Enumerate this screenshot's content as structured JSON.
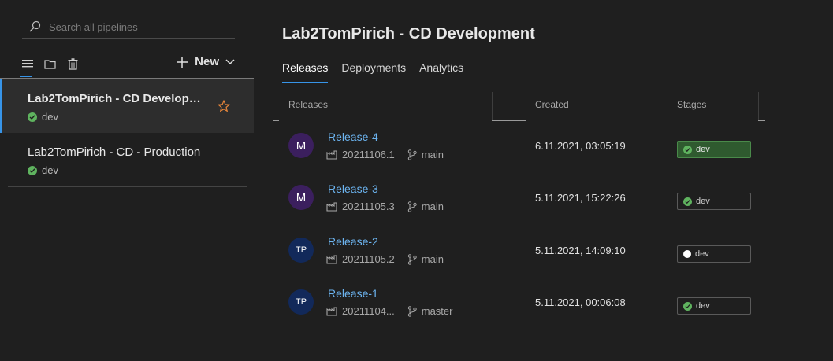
{
  "sidebar": {
    "search_placeholder": "Search all pipelines",
    "new_label": "New",
    "pipelines": [
      {
        "name": "Lab2TomPirich - CD Developm...",
        "env": "dev",
        "selected": true
      },
      {
        "name": "Lab2TomPirich - CD - Production",
        "env": "dev",
        "selected": false
      }
    ]
  },
  "main": {
    "title": "Lab2TomPirich - CD Development",
    "tabs": [
      {
        "label": "Releases",
        "active": true
      },
      {
        "label": "Deployments",
        "active": false
      },
      {
        "label": "Analytics",
        "active": false
      }
    ],
    "columns": {
      "releases": "Releases",
      "created": "Created",
      "stages": "Stages"
    },
    "releases": [
      {
        "avatar": "M",
        "avatar_color": "#3b1f5e",
        "name": "Release-4",
        "build": "20211106.1",
        "branch": "main",
        "created": "6.11.2021, 03:05:19",
        "stage": "dev",
        "stage_status": "success"
      },
      {
        "avatar": "M",
        "avatar_color": "#3b1f5e",
        "name": "Release-3",
        "build": "20211105.3",
        "branch": "main",
        "created": "5.11.2021, 15:22:26",
        "stage": "dev",
        "stage_status": "ok"
      },
      {
        "avatar": "TP",
        "avatar_color": "#12295a",
        "name": "Release-2",
        "build": "20211105.2",
        "branch": "main",
        "created": "5.11.2021, 14:09:10",
        "stage": "dev",
        "stage_status": "not-deployed"
      },
      {
        "avatar": "TP",
        "avatar_color": "#12295a",
        "name": "Release-1",
        "build": "20211104...",
        "branch": "master",
        "created": "5.11.2021, 00:06:08",
        "stage": "dev",
        "stage_status": "ok"
      }
    ]
  },
  "colors": {
    "accent": "#3794e8",
    "link": "#6cb4f0",
    "success": "#5fb35f",
    "star": "#e8863a"
  },
  "icons": [
    "search-icon",
    "list-view-icon",
    "folder-icon",
    "trash-icon",
    "plus-icon",
    "chevron-down-icon",
    "star-icon",
    "check-icon",
    "build-icon",
    "branch-icon"
  ]
}
